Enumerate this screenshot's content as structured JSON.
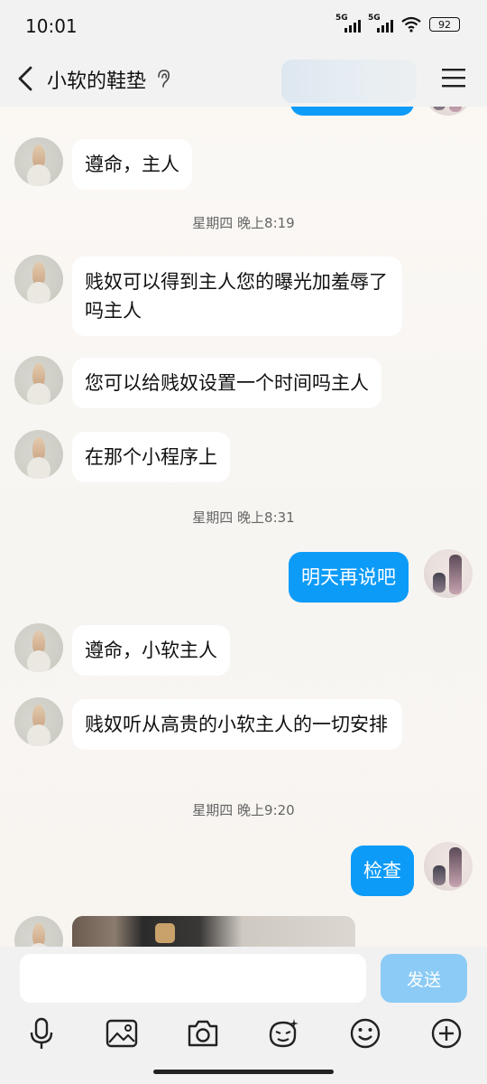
{
  "status": {
    "time": "10:01",
    "sim1": "5G",
    "sim2": "5G",
    "battery": "92"
  },
  "header": {
    "title": "小软的鞋垫"
  },
  "messages": [
    {
      "text": "遵命，主人"
    },
    {
      "timestamp": "星期四 晚上8:19"
    },
    {
      "text": "贱奴可以得到主人您的曝光加羞辱了吗主人"
    },
    {
      "text": "您可以给贱奴设置一个时间吗主人"
    },
    {
      "text": "在那个小程序上"
    },
    {
      "timestamp": "星期四 晚上8:31"
    },
    {
      "text": "明天再说吧"
    },
    {
      "text": "遵命，小软主人"
    },
    {
      "text": "贱奴听从高贵的小软主人的一切安排"
    },
    {
      "timestamp": "星期四 晚上9:20"
    },
    {
      "text": "检查"
    }
  ],
  "composer": {
    "placeholder": "",
    "send_label": "发送"
  },
  "toolbar": {
    "icons": [
      "mic-icon",
      "image-icon",
      "camera-icon",
      "sticker-icon",
      "emoji-icon",
      "plus-icon"
    ]
  },
  "colors": {
    "outgoing_bubble": "#0d9bf8",
    "send_button": "#8ccbf6"
  }
}
